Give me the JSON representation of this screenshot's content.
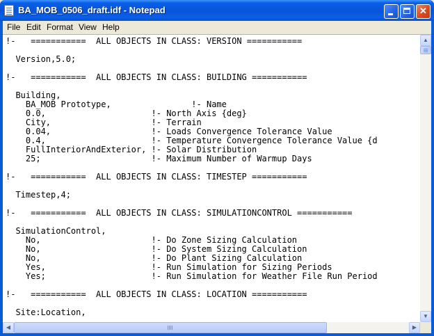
{
  "window": {
    "title": "BA_MOB_0506_draft.idf - Notepad",
    "icon": "notepad-icon"
  },
  "title_buttons": {
    "minimize": "minimize-icon",
    "maximize": "maximize-icon",
    "close_glyph": "✕"
  },
  "menu": [
    {
      "label": "File"
    },
    {
      "label": "Edit"
    },
    {
      "label": "Format"
    },
    {
      "label": "View"
    },
    {
      "label": "Help"
    }
  ],
  "document": {
    "lines": [
      {
        "text": "!-   ===========  ALL OBJECTS IN CLASS: VERSION ==========="
      },
      {
        "text": ""
      },
      {
        "text": "  Version,5.0;"
      },
      {
        "text": ""
      },
      {
        "text": "!-   ===========  ALL OBJECTS IN CLASS: BUILDING ==========="
      },
      {
        "text": ""
      },
      {
        "text": "  Building,"
      },
      {
        "text": "    BA_MOB Prototype,                !- Name"
      },
      {
        "text": "    0.0,                     !- North Axis {deg}"
      },
      {
        "text": "    City,                    !- Terrain"
      },
      {
        "text": "    0.04,                    !- Loads Convergence Tolerance Value"
      },
      {
        "text": "    0.4,                     !- Temperature Convergence Tolerance Value {d"
      },
      {
        "text": "    FullInteriorAndExterior, !- Solar Distribution"
      },
      {
        "text": "    25;                      !- Maximum Number of Warmup Days"
      },
      {
        "text": ""
      },
      {
        "text": "!-   ===========  ALL OBJECTS IN CLASS: TIMESTEP ==========="
      },
      {
        "text": ""
      },
      {
        "text": "  Timestep,4;"
      },
      {
        "text": ""
      },
      {
        "text": "!-   ===========  ALL OBJECTS IN CLASS: SIMULATIONCONTROL ==========="
      },
      {
        "text": ""
      },
      {
        "text": "  SimulationControl,"
      },
      {
        "text": "    No,                      !- Do Zone Sizing Calculation"
      },
      {
        "text": "    No,                      !- Do System Sizing Calculation"
      },
      {
        "text": "    No,                      !- Do Plant Sizing Calculation"
      },
      {
        "text": "    Yes,                     !- Run Simulation for Sizing Periods"
      },
      {
        "text": "    Yes;                     !- Run Simulation for Weather File Run Period"
      },
      {
        "text": ""
      },
      {
        "text": "!-   ===========  ALL OBJECTS IN CLASS: LOCATION ==========="
      },
      {
        "text": ""
      },
      {
        "text": "  Site:Location,"
      }
    ]
  },
  "scrollbars": {
    "up_arrow": "▲",
    "down_arrow": "▼",
    "left_arrow": "◀",
    "right_arrow": "▶"
  }
}
